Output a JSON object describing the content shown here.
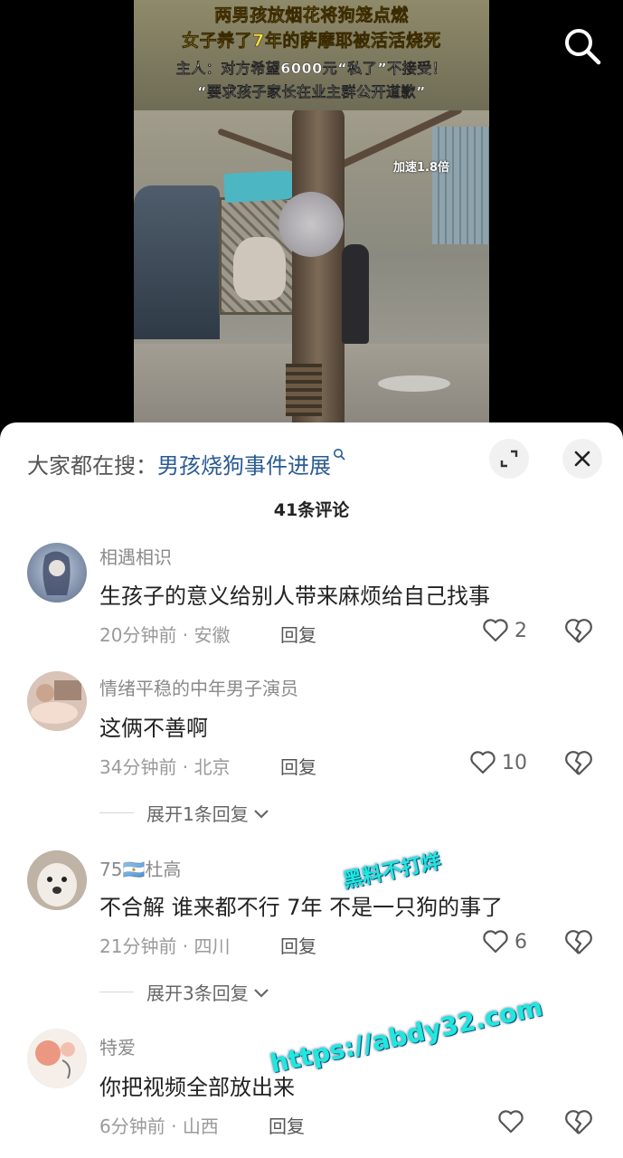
{
  "video": {
    "caption_lines": [
      "两男孩放烟花将狗笼点燃",
      "女子养了7年的萨摩耶被活活烧死",
      "主人：对方希望6000元“私了”不接受！",
      "“要求孩子家长在业主群公开道歉”"
    ],
    "speed_badge": "加速1.8倍",
    "search_icon": "search-icon"
  },
  "hot_search": {
    "prefix": "大家都在搜：",
    "link": "男孩烧狗事件进展"
  },
  "comments_header": {
    "count_label": "41条评论"
  },
  "comments": [
    {
      "username": "相遇相识",
      "text": "生孩子的意义给别人带来麻烦给自己找事",
      "time": "20分钟前",
      "location": "安徽",
      "reply_label": "回复",
      "likes": "2"
    },
    {
      "username": "情绪平稳的中年男子演员",
      "text": "这俩不善啊",
      "time": "34分钟前",
      "location": "北京",
      "reply_label": "回复",
      "likes": "10",
      "expand": "展开1条回复"
    },
    {
      "username": "75🇦🇷杜高",
      "text": "不合解 谁来都不行 7年 不是一只狗的事了",
      "time": "21分钟前",
      "location": "四川",
      "reply_label": "回复",
      "likes": "6",
      "expand": "展开3条回复"
    },
    {
      "username": "特爱",
      "text": "你把视频全部放出来",
      "time": "6分钟前",
      "location": "山西",
      "reply_label": "回复",
      "likes": ""
    }
  ],
  "meta_separator": " · ",
  "watermark": {
    "line1": "黑料不打烊",
    "line2": "https://abdy32.com"
  },
  "colors": {
    "link": "#2a5b93",
    "watermark": "#1ee9dc",
    "caption_yellow": "#f6e04a"
  }
}
